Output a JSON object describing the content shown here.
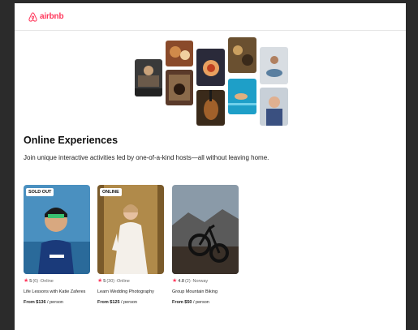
{
  "header": {
    "logo_text": "airbnb",
    "logo_icon": "airbnb-belo-icon",
    "brand_color": "#ff385c"
  },
  "main": {
    "title": "Online Experiences",
    "subtitle": "Join unique interactive activities led by one-of-a-kind hosts—all without leaving home."
  },
  "cards": [
    {
      "badge": "SOLD OUT",
      "rating": "5",
      "reviews": "(6)",
      "location": "·Online",
      "title": "Life Lessons with Katie Zaferes",
      "price_prefix": "From ",
      "price": "$136",
      "price_suffix": " / person"
    },
    {
      "badge": "ONLINE",
      "rating": "5",
      "reviews": "(30)",
      "location": "·Online",
      "title": "Learn Wedding Photography",
      "price_prefix": "From ",
      "price": "$125",
      "price_suffix": " / person"
    },
    {
      "badge": "",
      "rating": "4.8",
      "reviews": "(2)",
      "location": "·Norway",
      "title": "Group Mountain Biking",
      "price_prefix": "From ",
      "price": "$50",
      "price_suffix": " / person"
    }
  ]
}
